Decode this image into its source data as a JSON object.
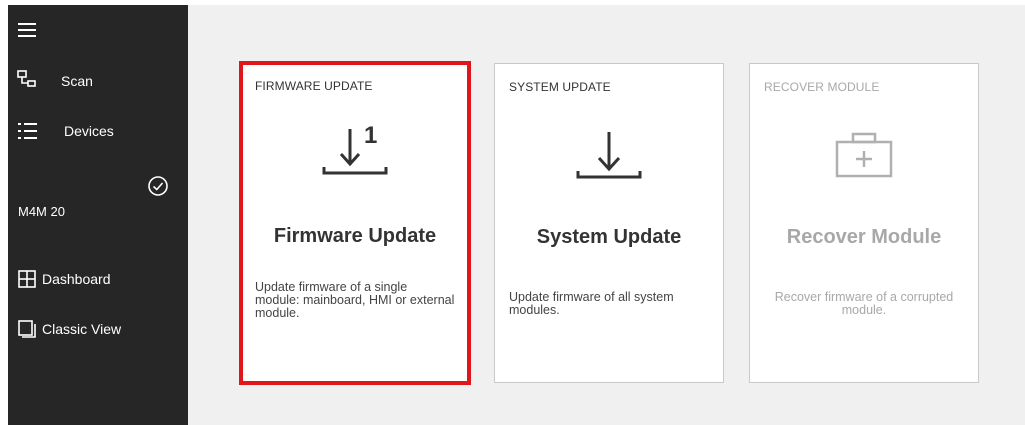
{
  "sidebar": {
    "items": [
      {
        "label": "Scan",
        "icon": "network-icon"
      },
      {
        "label": "Devices",
        "icon": "list-icon"
      }
    ],
    "device": {
      "name": "M4M 20",
      "status_icon": "check-circle-icon"
    },
    "views": [
      {
        "label": "Dashboard",
        "icon": "grid-icon"
      },
      {
        "label": "Classic View",
        "icon": "copy-icon"
      }
    ]
  },
  "cards": [
    {
      "header": "FIRMWARE UPDATE",
      "title": "Firmware Update",
      "badge": "1",
      "description": "Update firmware of a single module: mainboard, HMI or external module.",
      "icon": "download-one-icon",
      "selected": true
    },
    {
      "header": "SYSTEM UPDATE",
      "title": "System Update",
      "description": "Update firmware of all system modules.",
      "icon": "download-icon"
    },
    {
      "header": "RECOVER MODULE",
      "title": "Recover Module",
      "description": "Recover firmware of a corrupted module.",
      "icon": "first-aid-kit-icon",
      "disabled": true
    }
  ],
  "colors": {
    "sidebar_bg": "#262626",
    "main_bg": "#f0f0f0",
    "selection_border": "#e0161b",
    "disabled_text": "#a8a8a8"
  }
}
